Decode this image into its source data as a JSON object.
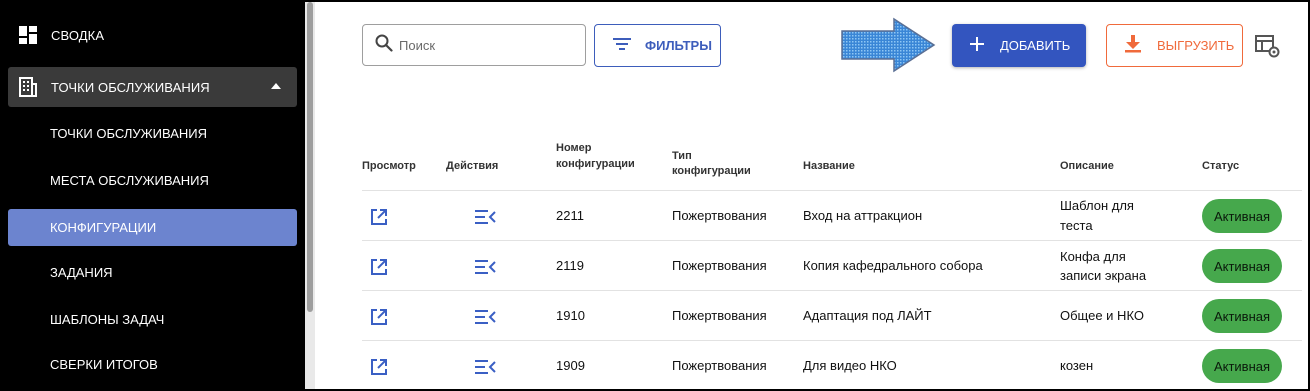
{
  "sidebar": {
    "top_item": {
      "label": "СВОДКА",
      "icon": "dashboard-icon"
    },
    "group": {
      "label": "ТОЧКИ ОБСЛУЖИВАНИЯ",
      "icon": "building-icon",
      "expanded": true
    },
    "items": [
      {
        "label": "ТОЧКИ ОБСЛУЖИВАНИЯ",
        "active": false
      },
      {
        "label": "МЕСТА ОБСЛУЖИВАНИЯ",
        "active": false
      },
      {
        "label": "КОНФИГУРАЦИИ",
        "active": true
      },
      {
        "label": "ЗАДАНИЯ",
        "active": false
      },
      {
        "label": "ШАБЛОНЫ ЗАДАЧ",
        "active": false
      },
      {
        "label": "СВЕРКИ ИТОГОВ",
        "active": false
      }
    ]
  },
  "toolbar": {
    "search_placeholder": "Поиск",
    "filter_label": "ФИЛЬТРЫ",
    "add_label": "ДОБАВИТЬ",
    "export_label": "ВЫГРУЗИТЬ"
  },
  "table": {
    "headers": {
      "view": "Просмотр",
      "actions": "Действия",
      "config_number": [
        "Номер",
        "конфигурации"
      ],
      "config_type": [
        "Тип",
        "конфигурации"
      ],
      "name": "Название",
      "description": "Описание",
      "status": "Статус"
    },
    "rows": [
      {
        "number": "2211",
        "type": "Пожертвования",
        "name": "Вход на аттракцион",
        "description": [
          "Шаблон для",
          "теста"
        ],
        "status": "Активная"
      },
      {
        "number": "2119",
        "type": "Пожертвования",
        "name": "Копия кафедрального собора",
        "description": [
          "Конфа для",
          "записи экрана"
        ],
        "status": "Активная"
      },
      {
        "number": "1910",
        "type": "Пожертвования",
        "name": "Адаптация под ЛАЙТ",
        "description": [
          "Общее и НКО"
        ],
        "status": "Активная"
      },
      {
        "number": "1909",
        "type": "Пожертвования",
        "name": "Для видео НКО",
        "description": [
          "козен"
        ],
        "status": "Активная"
      }
    ]
  },
  "colors": {
    "sidebar_bg": "#000000",
    "active_item": "#6c84cf",
    "primary": "#3355bf",
    "export": "#f06a3b",
    "status_active": "#46a84c"
  }
}
